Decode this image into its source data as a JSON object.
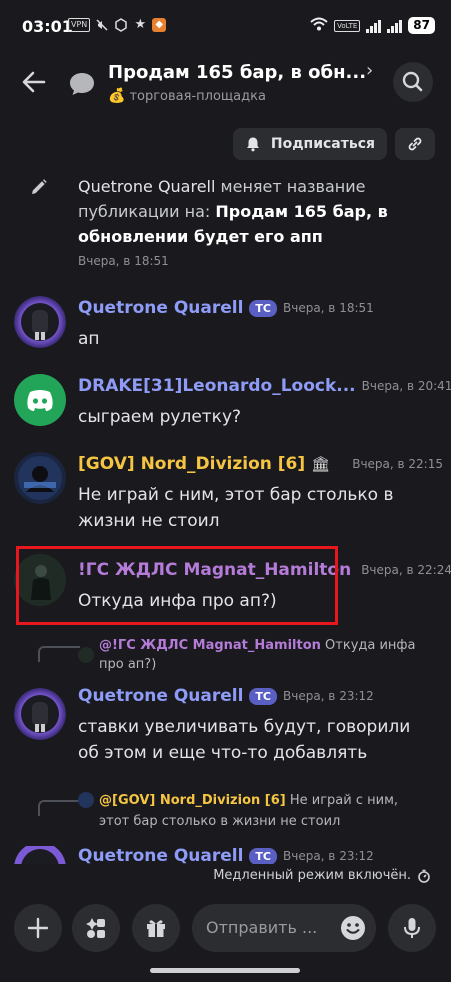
{
  "status_bar": {
    "time": "03:01",
    "vpn": "VPN",
    "volte": "VoLTE",
    "battery": "87"
  },
  "header": {
    "title": "Продам 165 бар, в обн...",
    "channel_emoji": "💰",
    "channel_name": "торговая-площадка"
  },
  "actions": {
    "subscribe_label": "Подписаться"
  },
  "system_message": {
    "author": "Quetrone Quarell",
    "text_pre": " меняет название публикации на: ",
    "new_title": "Продам 165 бар, в обновлении будет его апп",
    "time": "Вчера, в 18:51"
  },
  "messages": [
    {
      "author": "Quetrone Quarell",
      "tag": "TC",
      "time": "Вчера, в 18:51",
      "text": "ап",
      "author_color": "#8e9cf7"
    },
    {
      "author": "DRAKE[31]Leonardo_Loock...",
      "tag": "",
      "time": "Вчера, в 20:41",
      "text": "сыграем рулетку?",
      "author_color": "#8e9cf7"
    },
    {
      "author": "[GOV] Nord_Divizion [6]",
      "tag": "",
      "badge": "🏛",
      "time": "Вчера, в 22:15",
      "text": "Не играй с ним, этот бар столько в жизни не стоил",
      "author_color": "#f5c542"
    },
    {
      "author": "!ГС ЖДЛС Magnat_Hamilton",
      "tag": "",
      "time": "Вчера, в 22:24",
      "text": "Откуда инфа про ап?)",
      "author_color": "#b57bd8"
    },
    {
      "author": "Quetrone Quarell",
      "tag": "TC",
      "time": "Вчера, в 23:12",
      "text": "ставки увеличивать будут, говорили об этом и еще что-то добавлять",
      "author_color": "#8e9cf7"
    },
    {
      "author": "Quetrone Quarell",
      "tag": "TC",
      "time": "Вчера, в 23:12",
      "text": "",
      "author_color": "#8e9cf7"
    }
  ],
  "replies": [
    {
      "mention": "@!ГС ЖДЛС Magnat_Hamilton",
      "text": " Откуда инфа про ап?)",
      "mention_color": "#b57bd8"
    },
    {
      "mention": "@[GOV] Nord_Divizion [6]",
      "text": " Не играй с ним, этот бар столько в жизни не стоил",
      "mention_color": "#f5c542"
    }
  ],
  "slow_mode": "Медленный режим включён.",
  "composer": {
    "placeholder": "Отправить ..."
  },
  "colors": {
    "background": "#1a1a1e",
    "button_bg": "#2b2d31",
    "highlight": "#e8171e",
    "tag_bg": "#5a5fc4"
  }
}
